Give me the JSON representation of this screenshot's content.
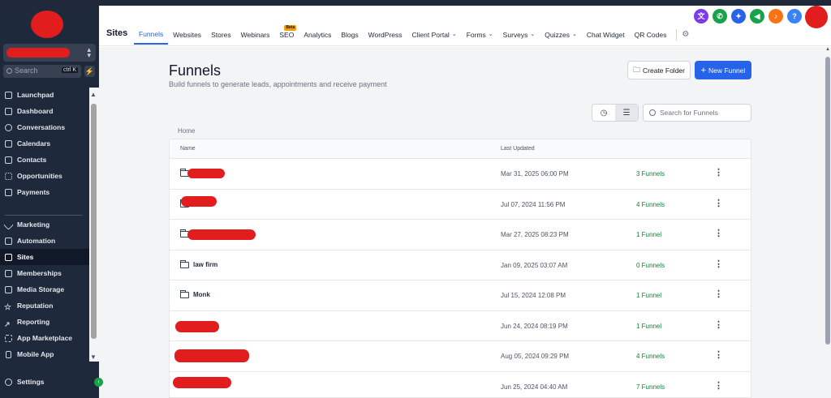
{
  "sidebar": {
    "search_placeholder": "Search",
    "search_shortcut": "ctrl K",
    "items": [
      {
        "label": "Launchpad",
        "icon": "rocket-icon"
      },
      {
        "label": "Dashboard",
        "icon": "dashboard-icon"
      },
      {
        "label": "Conversations",
        "icon": "chat-icon"
      },
      {
        "label": "Calendars",
        "icon": "calendar-icon"
      },
      {
        "label": "Contacts",
        "icon": "contacts-icon"
      },
      {
        "label": "Opportunities",
        "icon": "opportunities-icon"
      },
      {
        "label": "Payments",
        "icon": "payments-icon"
      },
      {
        "label": "Marketing",
        "icon": "send-icon"
      },
      {
        "label": "Automation",
        "icon": "automation-icon"
      },
      {
        "label": "Sites",
        "icon": "sites-icon",
        "active": true
      },
      {
        "label": "Memberships",
        "icon": "memberships-icon"
      },
      {
        "label": "Media Storage",
        "icon": "media-icon"
      },
      {
        "label": "Reputation",
        "icon": "star-icon"
      },
      {
        "label": "Reporting",
        "icon": "chart-icon"
      },
      {
        "label": "App Marketplace",
        "icon": "marketplace-icon"
      },
      {
        "label": "Mobile App",
        "icon": "mobile-icon"
      }
    ],
    "settings_label": "Settings"
  },
  "header": {
    "section_title": "Sites",
    "tabs": [
      {
        "label": "Funnels",
        "active": true
      },
      {
        "label": "Websites"
      },
      {
        "label": "Stores"
      },
      {
        "label": "Webinars"
      },
      {
        "label": "SEO",
        "badge": "Beta"
      },
      {
        "label": "Analytics"
      },
      {
        "label": "Blogs"
      },
      {
        "label": "WordPress"
      },
      {
        "label": "Client Portal",
        "dropdown": true
      },
      {
        "label": "Forms",
        "dropdown": true
      },
      {
        "label": "Surveys",
        "dropdown": true
      },
      {
        "label": "Quizzes",
        "dropdown": true
      },
      {
        "label": "Chat Widget"
      },
      {
        "label": "QR Codes"
      }
    ],
    "icons": [
      {
        "name": "translate-icon",
        "color": "#7c3aed",
        "glyph": "文"
      },
      {
        "name": "phone-icon",
        "color": "#16a34a",
        "glyph": "✆"
      },
      {
        "name": "magic-wand-icon",
        "color": "#2563eb",
        "glyph": "✦"
      },
      {
        "name": "megaphone-icon",
        "color": "#16a34a",
        "glyph": "◀"
      },
      {
        "name": "bell-icon",
        "color": "#f97316",
        "glyph": "♪"
      },
      {
        "name": "help-icon",
        "color": "#3b82f6",
        "glyph": "?"
      }
    ]
  },
  "page": {
    "title": "Funnels",
    "subtitle": "Build funnels to generate leads, appointments and receive payment",
    "create_folder_label": "Create Folder",
    "new_funnel_label": "New Funnel",
    "search_placeholder": "Search for Funnels",
    "breadcrumb": "Home"
  },
  "table": {
    "columns": [
      "Name",
      "Last Updated"
    ],
    "rows": [
      {
        "name": "",
        "redacted": true,
        "updated": "Mar 31, 2025 06:00 PM",
        "count": "3 Funnels"
      },
      {
        "name": "",
        "redacted": true,
        "updated": "Jul 07, 2024 11:56 PM",
        "count": "4 Funnels"
      },
      {
        "name": "",
        "redacted": true,
        "updated": "Mar 27, 2025 08:23 PM",
        "count": "1 Funnel"
      },
      {
        "name": "law firm",
        "redacted": false,
        "updated": "Jan 09, 2025 03:07 AM",
        "count": "0 Funnels"
      },
      {
        "name": "Monk",
        "redacted": false,
        "updated": "Jul 15, 2024 12:08 PM",
        "count": "1 Funnel"
      },
      {
        "name": "",
        "redacted": true,
        "updated": "Jun 24, 2024 08:19 PM",
        "count": "1 Funnel"
      },
      {
        "name": "",
        "redacted": true,
        "updated": "Aug 05, 2024 09:29 PM",
        "count": "4 Funnels"
      },
      {
        "name": "",
        "redacted": true,
        "updated": "Jun 25, 2024 04:40 AM",
        "count": "7 Funnels"
      }
    ]
  },
  "colors": {
    "accent": "#2563eb",
    "sidebar_bg": "#1e293b",
    "count_green": "#15803d",
    "redaction": "#e11d1d"
  }
}
